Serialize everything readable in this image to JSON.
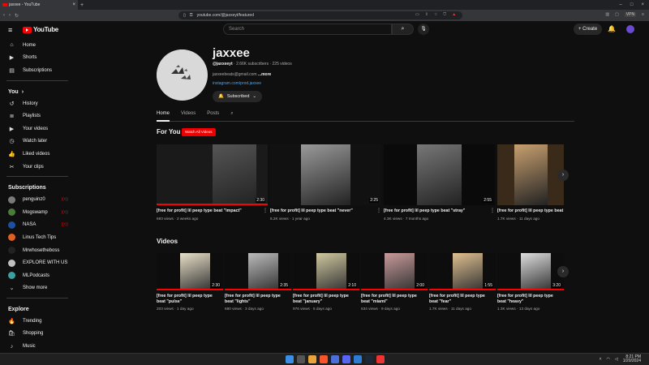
{
  "browser": {
    "tab_title": "jaxxee - YouTube",
    "url": "youtube.com/@jaxxeyt/featured",
    "vpn_label": "VPN"
  },
  "masthead": {
    "search_placeholder": "Search",
    "create_label": "Create"
  },
  "sidebar": {
    "main": [
      {
        "label": "Home",
        "icon": "home-icon"
      },
      {
        "label": "Shorts",
        "icon": "shorts-icon"
      },
      {
        "label": "Subscriptions",
        "icon": "subscriptions-icon"
      }
    ],
    "you_heading": "You",
    "you": [
      {
        "label": "History",
        "icon": "history-icon"
      },
      {
        "label": "Playlists",
        "icon": "playlists-icon"
      },
      {
        "label": "Your videos",
        "icon": "your-videos-icon"
      },
      {
        "label": "Watch later",
        "icon": "watch-later-icon"
      },
      {
        "label": "Liked videos",
        "icon": "like-icon"
      },
      {
        "label": "Your clips",
        "icon": "clips-icon"
      }
    ],
    "subs_heading": "Subscriptions",
    "subs": [
      {
        "label": "penguinz0",
        "color": "#7a7a7a",
        "live": true
      },
      {
        "label": "Mogswamp",
        "color": "#4b7a3d",
        "live": true
      },
      {
        "label": "NASA",
        "color": "#1d4fa3",
        "live": true
      },
      {
        "label": "Linus Tech Tips",
        "color": "#e06020",
        "live": false
      },
      {
        "label": "Mrwhosetheboss",
        "color": "#222222",
        "live": false
      },
      {
        "label": "EXPLORE WITH US",
        "color": "#c0c0c0",
        "live": false
      },
      {
        "label": "MLPodcasts",
        "color": "#3aa0a0",
        "live": false
      }
    ],
    "show_more": "Show more",
    "explore_heading": "Explore",
    "explore": [
      {
        "label": "Trending",
        "icon": "trending-icon"
      },
      {
        "label": "Shopping",
        "icon": "shopping-icon"
      },
      {
        "label": "Music",
        "icon": "music-icon"
      }
    ]
  },
  "channel": {
    "name": "jaxxee",
    "handle": "@jaxxeeyt",
    "stats": " · 2.66K subscribers · 225 videos",
    "email": "jaxxeebeats@gmail.com ",
    "more": "...more",
    "link": "instagram.com/prod.jaxxee",
    "subscribed_label": "Subscribed"
  },
  "tabs": [
    "Home",
    "Videos",
    "Posts"
  ],
  "for_you": {
    "heading": "For You",
    "watch_all": "Watch All Videos",
    "items": [
      {
        "title": "[free for profit] lil peep type beat \"impact\"",
        "meta": "693 views · 2 weeks ago",
        "duration": "2:30",
        "progress": 1.0
      },
      {
        "title": "[free for profit] lil peep type beat \"never\"",
        "meta": "6.2K views · 1 year ago",
        "duration": "2:25",
        "progress": 0
      },
      {
        "title": "[free for profit] lil peep type beat \"stray\"",
        "meta": "4.3K views · 7 months ago",
        "duration": "2:55",
        "progress": 0
      },
      {
        "title": "[free for profit] lil peep type beat \"",
        "meta": "1.7K views · 11 days ago",
        "duration": "",
        "progress": 0
      }
    ]
  },
  "videos": {
    "heading": "Videos",
    "items": [
      {
        "title_1": "[free for profit] lil peep type",
        "title_2": "beat \"pulse\"",
        "meta": "203 views · 1 day ago",
        "duration": "2:30"
      },
      {
        "title_1": "[free for profit] lil peep type",
        "title_2": "beat \"lights\"",
        "meta": "680 views · 3 days ago",
        "duration": "2:35"
      },
      {
        "title_1": "[free for profit] lil peep type",
        "title_2": "beat \"january\"",
        "meta": "976 views · 5 days ago",
        "duration": "2:10"
      },
      {
        "title_1": "[free for profit] lil peep type",
        "title_2": "beat \"miami\"",
        "meta": "634 views · 9 days ago",
        "duration": "2:00"
      },
      {
        "title_1": "[free for profit] lil peep type",
        "title_2": "beat \"fear\"",
        "meta": "1.7K views · 11 days ago",
        "duration": "1:55"
      },
      {
        "title_1": "[free for profit] lil peep type",
        "title_2": "beat \"heavy\"",
        "meta": "1.3K views · 13 days ago",
        "duration": "3:20"
      }
    ]
  },
  "taskbar": {
    "time": "8:21 PM",
    "date": "1/20/2024"
  }
}
